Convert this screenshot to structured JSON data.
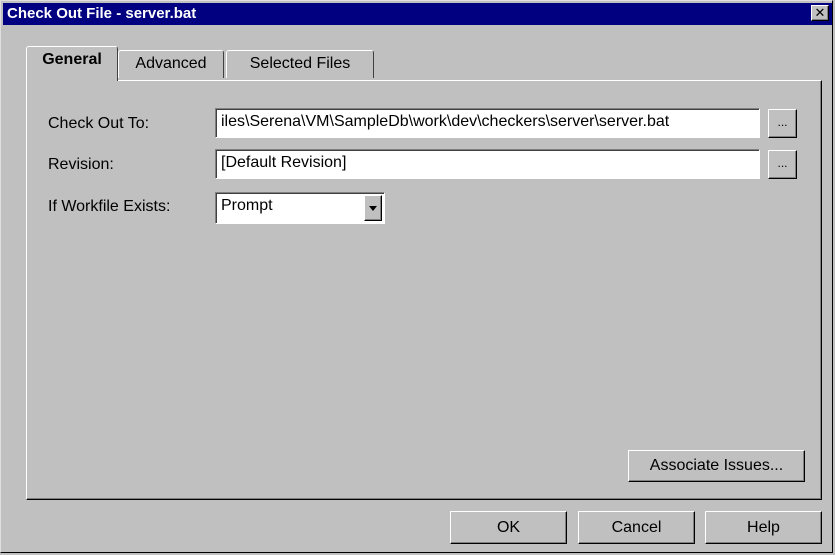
{
  "window": {
    "title": "Check Out File - server.bat",
    "close_glyph": "✕"
  },
  "tabs": [
    {
      "label": "General",
      "active": true
    },
    {
      "label": "Advanced",
      "active": false
    },
    {
      "label": "Selected Files",
      "active": false
    }
  ],
  "form": {
    "check_out_to": {
      "label": "Check Out To:",
      "value": "iles\\Serena\\VM\\SampleDb\\work\\dev\\checkers\\server\\server.bat",
      "browse_label": "..."
    },
    "revision": {
      "label": "Revision:",
      "value": "[Default Revision]",
      "browse_label": "..."
    },
    "if_workfile_exists": {
      "label": "If Workfile Exists:",
      "selected": "Prompt"
    }
  },
  "associate_issues_label": "Associate Issues...",
  "footer": {
    "ok_label": "OK",
    "cancel_label": "Cancel",
    "help_label": "Help"
  }
}
